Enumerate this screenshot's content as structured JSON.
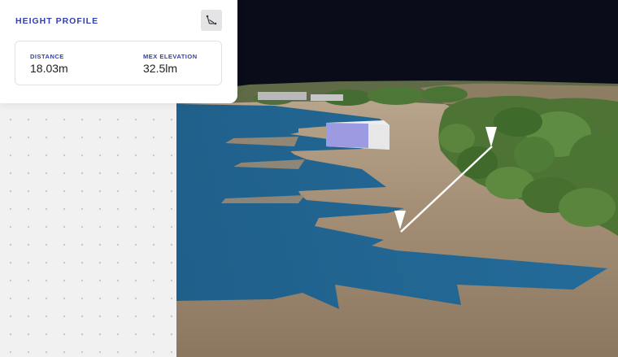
{
  "height_profile": {
    "title": "HEIGHT PROFILE",
    "tool_icon": "measure-profile-icon",
    "distance": {
      "label": "DISTANCE",
      "value": "18.03m"
    },
    "elevation": {
      "label": "MEX ELEVATION",
      "value": "32.5lm"
    }
  },
  "scene": {
    "water_color": "#1d6596",
    "ground_color": "#a18c73",
    "sky_color": "#0b0c1a",
    "vegetation_color": "#4f7a35",
    "building_color": "#9c9ae0",
    "measure_line_color": "#ffffff"
  }
}
